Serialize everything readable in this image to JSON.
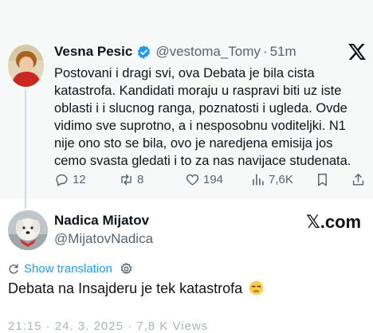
{
  "quoted_tweet": {
    "author_name": "Vesna Pesic",
    "handle": "@vestoma_Tomy",
    "separator": "·",
    "time": "51m",
    "lines": [
      "Postovani i dragi svi, ova Debata je bila cista",
      "katastrofa. Kandidati moraju u raspravi biti uz iste",
      "oblasti i i slucnog ranga, poznatosti i ugleda.  Ovde",
      "vidimo sve suprotno, a i nesposobnu voditeljki. N1",
      "nije ono sto se bila, ovo je naredjena emisija jos",
      "cemo svasta gledati i to za nas navijace studenata."
    ],
    "replies": "12",
    "reposts": "8",
    "likes": "194",
    "views": "7,6K"
  },
  "reply": {
    "author_name": "Nadica Mijatov",
    "handle": "@MijatovNadica",
    "brand": "𝕏.com",
    "show_translation": "Show translation",
    "text": "Debata na Insajderu je tek katastrofa",
    "footer_partial": "21:15 · 24. 3. 2025 · 7,8 K Views"
  },
  "colors": {
    "accent": "#1d9bf0",
    "text": "#0f1419",
    "muted": "#536471",
    "quoted_bg": "#f7f9f9"
  },
  "icons": [
    "verified-badge-icon",
    "x-logo-icon",
    "reply-icon",
    "repost-icon",
    "like-icon",
    "views-icon",
    "bookmark-icon",
    "share-icon",
    "translate-icon",
    "settings-icon",
    "unamused-face-emoji"
  ]
}
